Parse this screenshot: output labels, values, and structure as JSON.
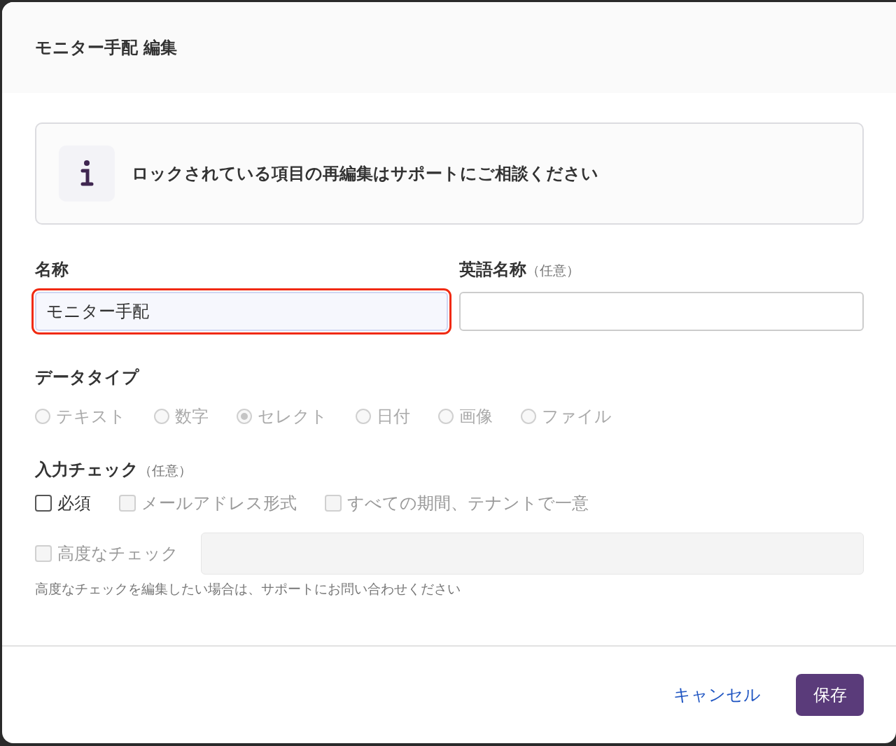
{
  "dialog": {
    "title": "モニター手配 編集"
  },
  "notice": {
    "text": "ロックされている項目の再編集はサポートにご相談ください"
  },
  "fields": [
    {
      "label": "名称",
      "value": "モニター手配",
      "highlighted": true
    },
    {
      "label": "英語名称",
      "optional": "（任意）",
      "highlighted": false
    }
  ],
  "data_type": {
    "label": "データタイプ",
    "options": [
      {
        "label": "テキスト",
        "selected": false,
        "disabled": true
      },
      {
        "label": "数字",
        "selected": false,
        "disabled": true
      },
      {
        "label": "セレクト",
        "selected": true,
        "disabled": true
      },
      {
        "label": "日付",
        "selected": false,
        "disabled": true
      },
      {
        "label": "画像",
        "selected": false,
        "disabled": true
      },
      {
        "label": "ファイル",
        "selected": false,
        "disabled": true
      }
    ]
  },
  "input_check": {
    "label": "入力チェック",
    "optional": "（任意）",
    "checks": [
      {
        "label": "必須",
        "checked": false,
        "disabled": false
      },
      {
        "label": "メールアドレス形式",
        "checked": false,
        "disabled": true
      },
      {
        "label": "すべての期間、テナントで一意",
        "checked": false,
        "disabled": true
      }
    ],
    "advanced": {
      "label": "高度なチェック",
      "checked": false,
      "disabled": true
    },
    "hint": "高度なチェックを編集したい場合は、サポートにお問い合わせください"
  },
  "buttons": {
    "cancel": "キャンセル",
    "save": "保存"
  }
}
